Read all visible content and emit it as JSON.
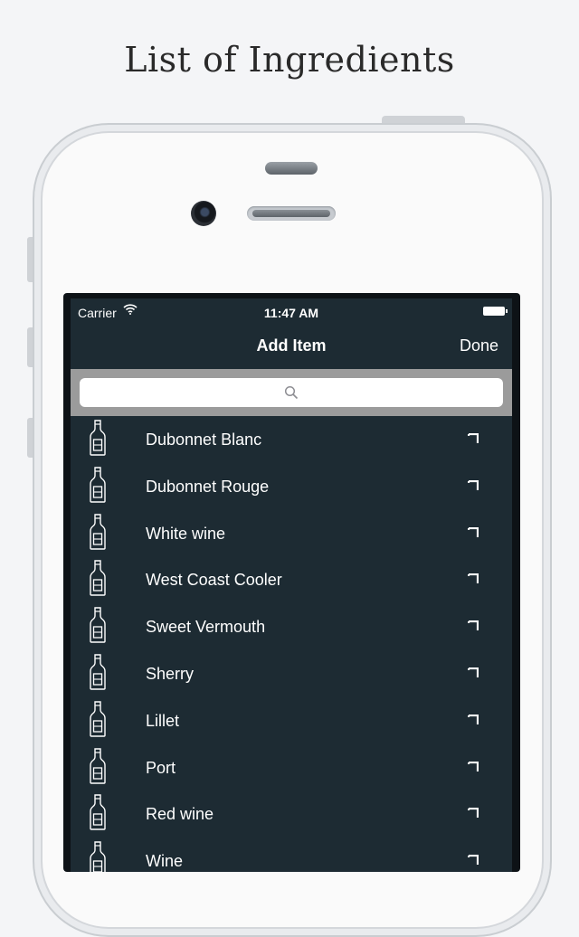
{
  "page": {
    "title": "List of Ingredients"
  },
  "status_bar": {
    "carrier": "Carrier",
    "time": "11:47 AM"
  },
  "nav": {
    "title": "Add Item",
    "done_label": "Done"
  },
  "search": {
    "placeholder": ""
  },
  "icons": {
    "row_icon": "bottle-icon",
    "row_checkbox": "checkbox-icon",
    "search": "search-icon"
  },
  "colors": {
    "background": "#1d2b33",
    "search_bar": "#9b9b9b",
    "text": "#ffffff"
  },
  "ingredients": [
    {
      "label": "Dubonnet Blanc"
    },
    {
      "label": "Dubonnet Rouge"
    },
    {
      "label": "White wine"
    },
    {
      "label": "West Coast Cooler"
    },
    {
      "label": "Sweet Vermouth"
    },
    {
      "label": "Sherry"
    },
    {
      "label": "Lillet"
    },
    {
      "label": "Port"
    },
    {
      "label": "Red wine"
    },
    {
      "label": "Wine"
    }
  ]
}
